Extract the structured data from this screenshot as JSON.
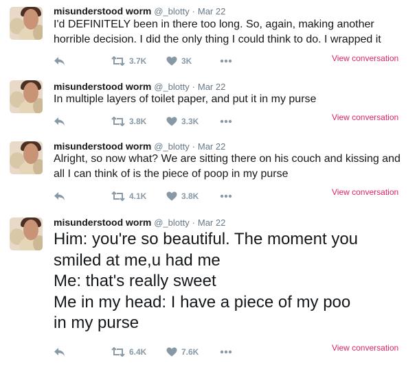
{
  "colors": {
    "accent": "#e0245e",
    "icon": "#8899a6",
    "meta": "#657786",
    "text": "#14171a"
  },
  "tweets": [
    {
      "name": "misunderstood worm",
      "handle": "@_blotty",
      "dot": "·",
      "date": "Mar 22",
      "lines": [
        "I'd DEFINITELY been in there too long. So, again, making another",
        "horrible decision. I did the only thing I could think to do. I wrapped it"
      ],
      "retweets": "3.7K",
      "likes": "3K",
      "view_conversation": "View conversation"
    },
    {
      "name": "misunderstood worm",
      "handle": "@_blotty",
      "dot": "·",
      "date": "Mar 22",
      "lines": [
        "In multiple layers of toilet paper, and put it in my purse"
      ],
      "retweets": "3.8K",
      "likes": "3.3K",
      "view_conversation": "View conversation"
    },
    {
      "name": "misunderstood worm",
      "handle": "@_blotty",
      "dot": "·",
      "date": "Mar 22",
      "lines": [
        "Alright, so now what? We are sitting there on his couch and kissing and",
        "all I can think of is the piece of poop in my purse"
      ],
      "retweets": "4.1K",
      "likes": "3.8K",
      "view_conversation": "View conversation"
    },
    {
      "name": "misunderstood worm",
      "handle": "@_blotty",
      "dot": "·",
      "date": "Mar 22",
      "lines": [
        "Him: you're so beautiful. The moment you",
        "smiled at me,u had me",
        "Me: that's really sweet",
        "Me in my head: I have a piece of my poo",
        "in my purse"
      ],
      "retweets": "6.4K",
      "likes": "7.6K",
      "view_conversation": "View conversation"
    }
  ],
  "icons": {
    "reply": "reply-icon",
    "retweet": "retweet-icon",
    "like": "heart-icon",
    "more": "more-icon"
  }
}
